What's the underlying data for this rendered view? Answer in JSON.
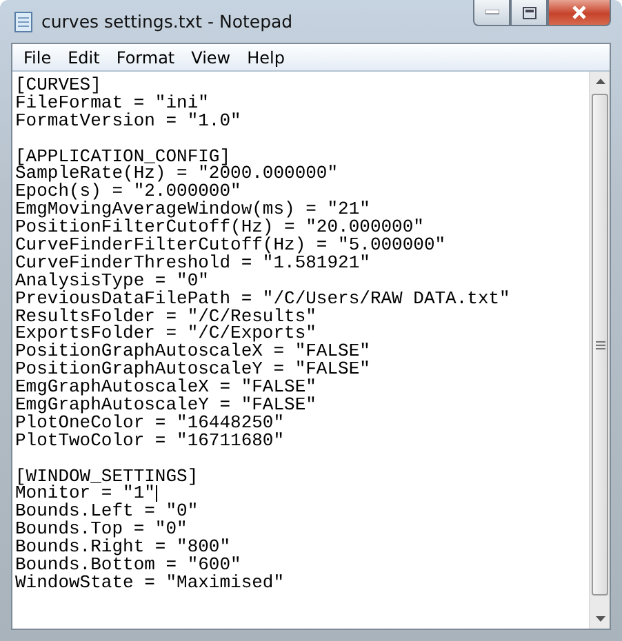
{
  "window": {
    "title": "curves settings.txt - Notepad"
  },
  "menu": [
    "File",
    "Edit",
    "Format",
    "View",
    "Help"
  ],
  "document": {
    "sections": [
      {
        "header": "[CURVES]",
        "lines": [
          {
            "text": "FileFormat = \"ini\"",
            "caret": false
          },
          {
            "text": "FormatVersion = \"1.0\"",
            "caret": false
          }
        ]
      },
      {
        "header": "[APPLICATION_CONFIG]",
        "lines": [
          {
            "text": "SampleRate(Hz) = \"2000.000000\"",
            "caret": false
          },
          {
            "text": "Epoch(s) = \"2.000000\"",
            "caret": false
          },
          {
            "text": "EmgMovingAverageWindow(ms) = \"21\"",
            "caret": false
          },
          {
            "text": "PositionFilterCutoff(Hz) = \"20.000000\"",
            "caret": false
          },
          {
            "text": "CurveFinderFilterCutoff(Hz) = \"5.000000\"",
            "caret": false
          },
          {
            "text": "CurveFinderThreshold = \"1.581921\"",
            "caret": false
          },
          {
            "text": "AnalysisType = \"0\"",
            "caret": false
          },
          {
            "text": "PreviousDataFilePath = \"/C/Users/RAW DATA.txt\"",
            "caret": false
          },
          {
            "text": "ResultsFolder = \"/C/Results\"",
            "caret": false
          },
          {
            "text": "ExportsFolder = \"/C/Exports\"",
            "caret": false
          },
          {
            "text": "PositionGraphAutoscaleX = \"FALSE\"",
            "caret": false
          },
          {
            "text": "PositionGraphAutoscaleY = \"FALSE\"",
            "caret": false
          },
          {
            "text": "EmgGraphAutoscaleX = \"FALSE\"",
            "caret": false
          },
          {
            "text": "EmgGraphAutoscaleY = \"FALSE\"",
            "caret": false
          },
          {
            "text": "PlotOneColor = \"16448250\"",
            "caret": false
          },
          {
            "text": "PlotTwoColor = \"16711680\"",
            "caret": false
          }
        ]
      },
      {
        "header": "[WINDOW_SETTINGS]",
        "lines": [
          {
            "text": "Monitor = \"1\"",
            "caret": true
          },
          {
            "text": "Bounds.Left = \"0\"",
            "caret": false
          },
          {
            "text": "Bounds.Top = \"0\"",
            "caret": false
          },
          {
            "text": "Bounds.Right = \"800\"",
            "caret": false
          },
          {
            "text": "Bounds.Bottom = \"600\"",
            "caret": false
          },
          {
            "text": "WindowState = \"Maximised\"",
            "caret": false
          }
        ]
      }
    ]
  }
}
